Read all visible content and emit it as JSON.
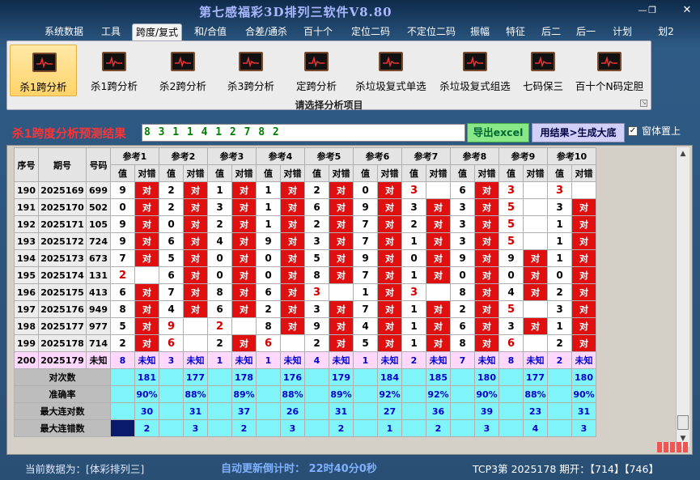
{
  "app": {
    "title": "第七感福彩3D排列三软件V8.80"
  },
  "menu": [
    "系统数据",
    "工具",
    "跨度/复式",
    "和/合值",
    "合差/通杀",
    "百十个",
    "定位二码",
    "不定位二码",
    "振幅",
    "特征",
    "后二",
    "后一",
    "计划",
    "划2"
  ],
  "ribbon": {
    "items": [
      "杀1跨分析",
      "杀1跨分析",
      "杀2跨分析",
      "杀3跨分析",
      "定跨分析",
      "杀垃圾复式单选",
      "杀垃圾复式组选",
      "七码保三",
      "百十个N码定胆"
    ],
    "caption": "请选择分析项目"
  },
  "result": {
    "title": "杀1跨度分析预测结果",
    "value": "8 3 1 1 4 1 2 7 8 2",
    "excel_button": "导出excel",
    "generate_button": "用结果>生成大底",
    "ontop_label": "窗体置上",
    "ontop_checked": "✓"
  },
  "table": {
    "headers": {
      "seq": "序号",
      "period": "期号",
      "number": "号码"
    },
    "refs": [
      "参考1",
      "参考2",
      "参考3",
      "参考4",
      "参考5",
      "参考6",
      "参考7",
      "参考8",
      "参考9",
      "参考10"
    ],
    "sub": {
      "value": "值",
      "hit": "对错"
    },
    "hit_word": "对",
    "unknown": "未知",
    "rows": [
      {
        "seq": "190",
        "period": "2025169",
        "num": "699",
        "cells": [
          [
            "9",
            1
          ],
          [
            "2",
            1
          ],
          [
            "1",
            1
          ],
          [
            "1",
            1
          ],
          [
            "2",
            1
          ],
          [
            "0",
            1
          ],
          [
            "3",
            0
          ],
          [
            "6",
            1
          ],
          [
            "3",
            0
          ],
          [
            "3",
            0
          ]
        ]
      },
      {
        "seq": "191",
        "period": "2025170",
        "num": "502",
        "cells": [
          [
            "0",
            1
          ],
          [
            "2",
            1
          ],
          [
            "3",
            1
          ],
          [
            "1",
            1
          ],
          [
            "6",
            1
          ],
          [
            "9",
            1
          ],
          [
            "3",
            1
          ],
          [
            "3",
            1
          ],
          [
            "5",
            0
          ],
          [
            "3",
            1
          ]
        ]
      },
      {
        "seq": "192",
        "period": "2025171",
        "num": "105",
        "cells": [
          [
            "9",
            1
          ],
          [
            "0",
            1
          ],
          [
            "2",
            1
          ],
          [
            "1",
            1
          ],
          [
            "2",
            1
          ],
          [
            "7",
            1
          ],
          [
            "2",
            1
          ],
          [
            "3",
            1
          ],
          [
            "5",
            0
          ],
          [
            "1",
            1
          ]
        ]
      },
      {
        "seq": "193",
        "period": "2025172",
        "num": "724",
        "cells": [
          [
            "9",
            1
          ],
          [
            "6",
            1
          ],
          [
            "4",
            1
          ],
          [
            "9",
            1
          ],
          [
            "3",
            1
          ],
          [
            "7",
            1
          ],
          [
            "1",
            1
          ],
          [
            "3",
            1
          ],
          [
            "5",
            0
          ],
          [
            "1",
            1
          ]
        ]
      },
      {
        "seq": "194",
        "period": "2025173",
        "num": "673",
        "cells": [
          [
            "7",
            1
          ],
          [
            "5",
            1
          ],
          [
            "0",
            1
          ],
          [
            "0",
            1
          ],
          [
            "5",
            1
          ],
          [
            "9",
            1
          ],
          [
            "0",
            1
          ],
          [
            "9",
            1
          ],
          [
            "9",
            1
          ],
          [
            "1",
            1
          ]
        ]
      },
      {
        "seq": "195",
        "period": "2025174",
        "num": "131",
        "cells": [
          [
            "2",
            0
          ],
          [
            "6",
            1
          ],
          [
            "0",
            1
          ],
          [
            "0",
            1
          ],
          [
            "8",
            1
          ],
          [
            "7",
            1
          ],
          [
            "1",
            1
          ],
          [
            "0",
            1
          ],
          [
            "0",
            1
          ],
          [
            "0",
            1
          ]
        ]
      },
      {
        "seq": "196",
        "period": "2025175",
        "num": "413",
        "cells": [
          [
            "6",
            1
          ],
          [
            "7",
            1
          ],
          [
            "8",
            1
          ],
          [
            "6",
            1
          ],
          [
            "3",
            0
          ],
          [
            "1",
            1
          ],
          [
            "3",
            0
          ],
          [
            "8",
            1
          ],
          [
            "4",
            1
          ],
          [
            "2",
            1
          ]
        ]
      },
      {
        "seq": "197",
        "period": "2025176",
        "num": "949",
        "cells": [
          [
            "8",
            1
          ],
          [
            "4",
            1
          ],
          [
            "6",
            1
          ],
          [
            "2",
            1
          ],
          [
            "3",
            1
          ],
          [
            "7",
            1
          ],
          [
            "1",
            1
          ],
          [
            "2",
            1
          ],
          [
            "5",
            0
          ],
          [
            "3",
            1
          ]
        ]
      },
      {
        "seq": "198",
        "period": "2025177",
        "num": "977",
        "cells": [
          [
            "5",
            1
          ],
          [
            "9",
            0
          ],
          [
            "2",
            0
          ],
          [
            "8",
            1
          ],
          [
            "9",
            1
          ],
          [
            "4",
            1
          ],
          [
            "1",
            1
          ],
          [
            "6",
            1
          ],
          [
            "3",
            1
          ],
          [
            "1",
            1
          ]
        ]
      },
      {
        "seq": "199",
        "period": "2025178",
        "num": "714",
        "cells": [
          [
            "2",
            1
          ],
          [
            "6",
            0
          ],
          [
            "2",
            1
          ],
          [
            "6",
            0
          ],
          [
            "2",
            1
          ],
          [
            "5",
            1
          ],
          [
            "1",
            1
          ],
          [
            "8",
            1
          ],
          [
            "6",
            0
          ],
          [
            "2",
            1
          ]
        ]
      },
      {
        "seq": "200",
        "period": "2025179",
        "num": "未知",
        "cells": [
          [
            "8",
            2
          ],
          [
            "3",
            2
          ],
          [
            "1",
            2
          ],
          [
            "1",
            2
          ],
          [
            "4",
            2
          ],
          [
            "1",
            2
          ],
          [
            "2",
            2
          ],
          [
            "7",
            2
          ],
          [
            "8",
            2
          ],
          [
            "2",
            2
          ]
        ]
      }
    ],
    "stats": [
      {
        "label": "对次数",
        "values": [
          "181",
          "177",
          "178",
          "176",
          "179",
          "184",
          "185",
          "180",
          "177",
          "180"
        ]
      },
      {
        "label": "准确率",
        "values": [
          "90%",
          "88%",
          "89%",
          "88%",
          "89%",
          "92%",
          "92%",
          "90%",
          "88%",
          "90%"
        ]
      },
      {
        "label": "最大连对数",
        "values": [
          "30",
          "31",
          "37",
          "26",
          "31",
          "27",
          "36",
          "39",
          "23",
          "31"
        ]
      },
      {
        "label": "最大连错数",
        "values": [
          "2",
          "3",
          "2",
          "3",
          "2",
          "1",
          "2",
          "3",
          "4",
          "3"
        ]
      }
    ]
  },
  "status": {
    "current_data": "当前数据为：[体彩排列三]",
    "countdown": "自动更新倒计时： 22时40分0秒",
    "latest": "TCP3第 2025178 期开：【714】【746】"
  },
  "colors": {
    "hit": "#e01010",
    "unknown_row": "#ffd7ff",
    "stats_row": "#7ff5fa",
    "accent_title": "#ff3333"
  }
}
